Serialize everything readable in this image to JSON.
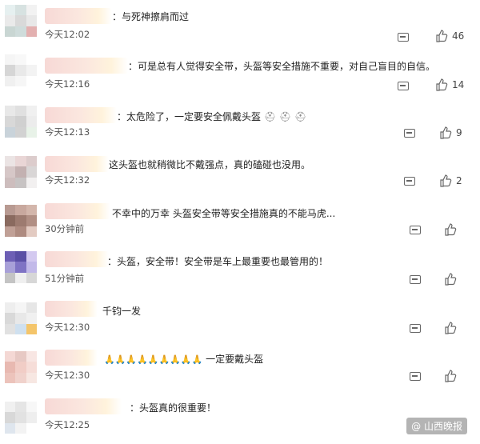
{
  "comments": [
    {
      "text": "：与死神擦肩而过",
      "time": "今天12:02",
      "likes": "46",
      "avatar": [
        "#e6f0f0",
        "#d7e2e1",
        "#f2f2f2",
        "#eaeaea",
        "#d9d9d9",
        "#e8e8e8",
        "#c9d6d3",
        "#cfdcdb",
        "#e3b0b0"
      ]
    },
    {
      "text": "：可是总有人觉得安全带，头盔等安全措施不重要，对自己盲目的自信。",
      "time": "今天12:16",
      "likes": "14",
      "avatar": [
        "#f5f5f5",
        "#f8f8f8",
        "#ffffff",
        "#d6d6d6",
        "#e9e9e9",
        "#f3f3f3",
        "#f0f0f0",
        "#f6f6f6",
        "#ffffff"
      ]
    },
    {
      "text": "：太危险了，一定要安全佩戴头盔",
      "time": "今天12:13",
      "likes": "9",
      "avatar": [
        "#e8e8e8",
        "#e0e0e0",
        "#f0f0f0",
        "#d8d8d8",
        "#d0d0d0",
        "#ececec",
        "#c9d3da",
        "#d2d2d2",
        "#e8f2e8"
      ]
    },
    {
      "text": "这头盔也就稍微比不戴强点，真的磕碰也没用。",
      "time": "今天12:32",
      "likes": "2",
      "avatar": [
        "#ebe4e4",
        "#e9d6d6",
        "#dccccc",
        "#d6c7c7",
        "#c3b1b1",
        "#d9d6d6",
        "#cdbdbd",
        "#c7c3c3",
        "#f2f0f0"
      ]
    },
    {
      "text": "不幸中的万幸 头盔安全带等安全措施真的不能马虎...",
      "time": "30分钟前",
      "likes": "",
      "avatar": [
        "#b89a92",
        "#c8a89e",
        "#d3b6ab",
        "#8a6a5f",
        "#9d7b70",
        "#b18f84",
        "#c0a096",
        "#ae8b80",
        "#e3cbc2"
      ]
    },
    {
      "text": "：头盔，安全带！安全带是车上最重要也最管用的！",
      "time": "51分钟前",
      "likes": "",
      "avatar": [
        "#6d5fb5",
        "#5a4fa5",
        "#d3c9f0",
        "#a8a0d8",
        "#7f73c4",
        "#c2b9e9",
        "#c4c4c4",
        "#efefef",
        "#d7d7d7"
      ]
    },
    {
      "text": "千钧一发",
      "time": "今天12:30",
      "likes": "",
      "avatar": [
        "#eeeeee",
        "#f5f5f5",
        "#e6e6e6",
        "#d9d9d9",
        "#e8e8e8",
        "#f0f0f0",
        "#e1e1e1",
        "#cfe0ef",
        "#f4c56a"
      ]
    },
    {
      "text": "一定要戴头盔",
      "time": "今天12:30",
      "likes": "",
      "avatar": [
        "#f4d8d4",
        "#e7c9c4",
        "#f8e6e3",
        "#e8b9b1",
        "#f1cdc6",
        "#f6ddd8",
        "#ecc3bb",
        "#f0d2cc",
        "#f7e7e2"
      ]
    },
    {
      "text": "：头盔真的很重要！",
      "time": "今天12:25",
      "likes": "",
      "avatar": [
        "#f0f0f0",
        "#e5e5e5",
        "#f7f7f7",
        "#d8d8d8",
        "#e2e2e2",
        "#eeeeee",
        "#dfe6ee",
        "#f3f3f3",
        "#ffffff"
      ]
    }
  ],
  "icons": {
    "reply": "comment-reply-icon",
    "like": "thumbs-up-icon",
    "prayer": "folded-hands-emoji",
    "helmet": "helmet-emoji"
  },
  "watermark": "@ 山西晚报"
}
